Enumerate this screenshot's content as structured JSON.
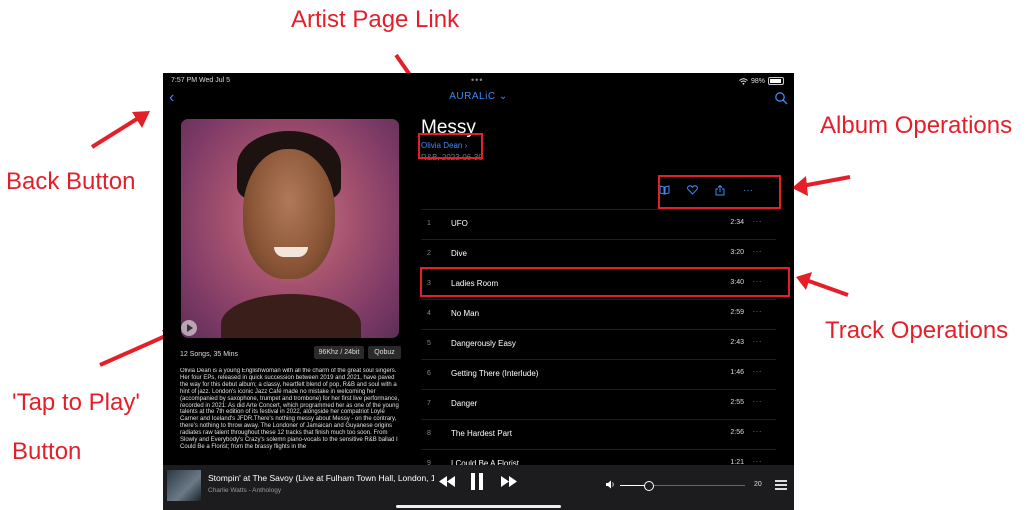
{
  "status_bar": {
    "time": "7:57 PM  Wed Jul 5",
    "battery": "98%"
  },
  "nav": {
    "title": "AURALiC",
    "chevron": "⌄"
  },
  "album": {
    "title": "Messy",
    "artist": "Olivia Dean",
    "meta": "R&B, 2023-06-30",
    "summary": "12 Songs, 35 Mins",
    "quality": "96Khz / 24bit",
    "source": "Qobuz",
    "description": "Olivia Dean is a young Englishwoman with all the charm of the great soul singers. Her four EPs, released in quick succession between 2019 and 2021, have paved the way for this debut album; a classy, heartfelt blend of pop, R&B and soul with a hint of jazz. London's iconic Jazz Café made no mistake in welcoming her (accompanied by saxophone, trumpet and trombone) for her first live performance, recorded in 2021. As did Arte Concert, which programmed her as one of the young talents at the 7th edition of its festival in 2022, alongside her compatriot Loyle Carner and Iceland's JFDR.There's nothing messy about Messy - on the contrary, there's nothing to throw away. The Londoner of Jamaican and Guyanese origins radiates raw talent throughout these 12 tracks that finish much too soon. From Slowly and Everybody's Crazy's solemn piano-vocals to the sensitive R&B ballad I Could Be a Florist; from the brassy flights in the"
  },
  "tracks": [
    {
      "num": "1",
      "title": "UFO",
      "duration": "2:34"
    },
    {
      "num": "2",
      "title": "Dive",
      "duration": "3:20"
    },
    {
      "num": "3",
      "title": "Ladies Room",
      "duration": "3:40"
    },
    {
      "num": "4",
      "title": "No Man",
      "duration": "2:59"
    },
    {
      "num": "5",
      "title": "Dangerously Easy",
      "duration": "2:43"
    },
    {
      "num": "6",
      "title": "Getting There (Interlude)",
      "duration": "1:46"
    },
    {
      "num": "7",
      "title": "Danger",
      "duration": "2:55"
    },
    {
      "num": "8",
      "title": "The Hardest Part",
      "duration": "2:56"
    },
    {
      "num": "9",
      "title": "I Could Be A Florist",
      "duration": "1:21"
    }
  ],
  "more_glyph": "···",
  "now_playing": {
    "title": "Stompin' at The Savoy  (Live at Fulham Town Hall, London, 1",
    "artist": "Charlie Watts - Anthology",
    "volume": "20",
    "volume_level": 0.2
  },
  "annotations": {
    "artist_link": "Artist Page Link",
    "album_ops": "Album Operations",
    "back": "Back Button",
    "track_ops": "Track Operations",
    "tap_play_1": "'Tap to Play'",
    "tap_play_2": "Button"
  },
  "colors": {
    "accent": "#3d8bf5",
    "annotation": "#e3202a",
    "background": "#000000"
  },
  "icons": [
    "back-chevron-icon",
    "search-icon",
    "wifi-icon",
    "battery-icon",
    "book-icon",
    "heart-icon",
    "share-icon",
    "more-icon",
    "play-icon",
    "rewind-icon",
    "pause-icon",
    "fast-forward-icon",
    "volume-icon",
    "queue-icon"
  ]
}
